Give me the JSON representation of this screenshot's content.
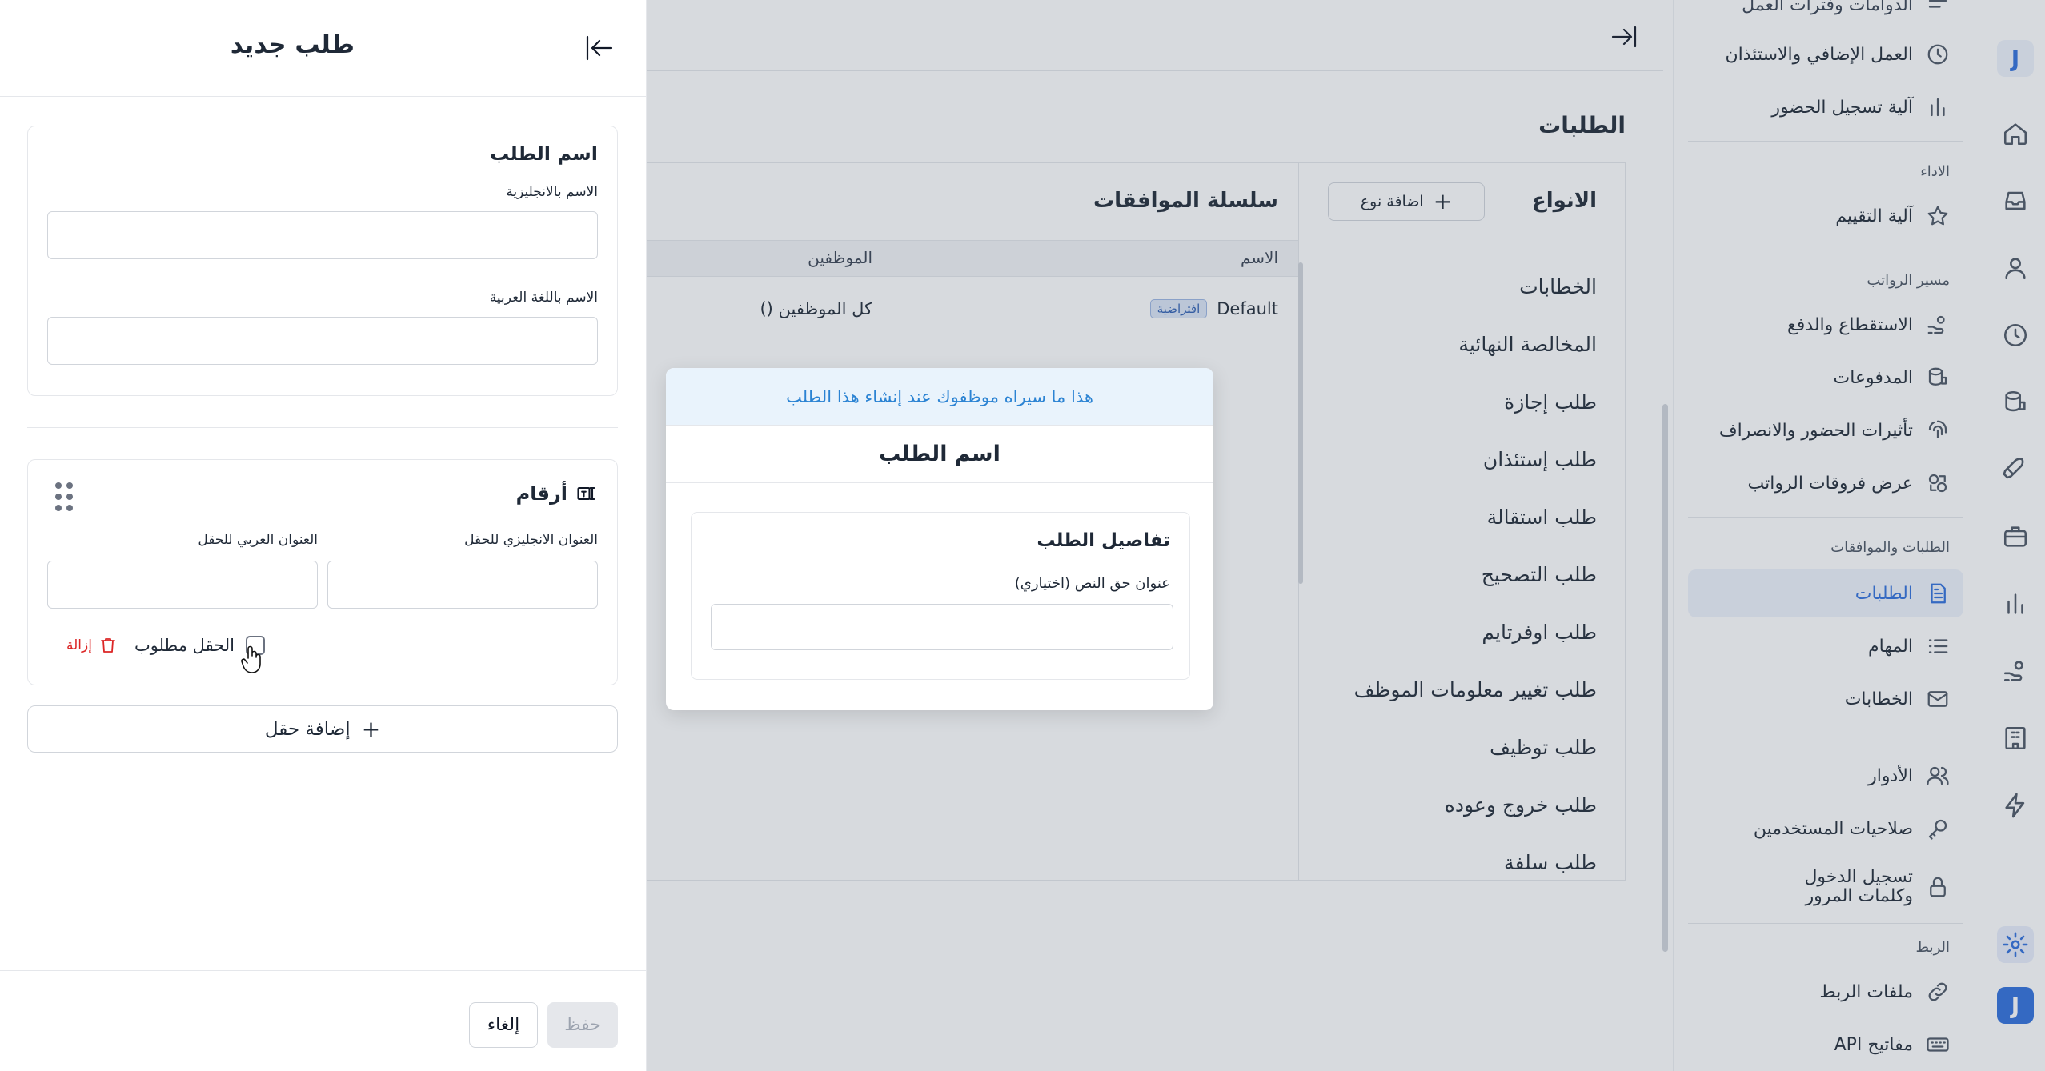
{
  "sidebar": {
    "top_partial": "الدوامات وفترات العمل",
    "items_top": [
      {
        "label": "العمل الإضافي والاستئذان",
        "icon": "clock-plus-icon"
      },
      {
        "label": "آلية تسجيل الحضور",
        "icon": "bar-chart-icon"
      }
    ],
    "section_performance": "الاداء",
    "item_rating": "آلية التقييم",
    "section_payroll": "مسير الرواتب",
    "payroll_items": [
      {
        "label": "الاستقطاع والدفع",
        "icon": "hand-coins-icon"
      },
      {
        "label": "المدفوعات",
        "icon": "coins-stack-icon"
      },
      {
        "label": "تأثيرات الحضور والانصراف",
        "icon": "fingerprint-icon"
      },
      {
        "label": "عرض فروقات الرواتب",
        "icon": "compare-icon"
      }
    ],
    "section_requests": "الطلبات والموافقات",
    "requests_items": [
      {
        "label": "الطلبات",
        "icon": "document-icon"
      },
      {
        "label": "المهام",
        "icon": "list-icon"
      },
      {
        "label": "الخطابات",
        "icon": "mail-icon"
      }
    ],
    "admin_items": [
      {
        "label": "الأدوار",
        "icon": "users-icon"
      },
      {
        "label": "صلاحيات المستخدمين",
        "icon": "key-icon"
      },
      {
        "label": "تسجيل الدخول وكلمات المرور",
        "icon": "lock-icon"
      }
    ],
    "section_integration": "الربط",
    "integration_items": [
      {
        "label": "ملفات الربط",
        "icon": "link-icon"
      },
      {
        "label": "مفاتيح API",
        "icon": "keyboard-icon"
      }
    ]
  },
  "rail": {
    "logo_letter": "J"
  },
  "main": {
    "page_title": "الطلبات",
    "types_title": "الانواع",
    "add_type_label": "اضافة نوع",
    "types": [
      "الخطابات",
      "المخالصة النهائية",
      "طلب إجازة",
      "طلب إستئذان",
      "طلب استقالة",
      "طلب التصحيح",
      "طلب اوفرتايم",
      "طلب تغيير معلومات الموظف",
      "طلب توظيف",
      "طلب خروج وعوده",
      "طلب سلفة"
    ],
    "chain_title": "سلسلة الموافقات",
    "col_name": "الاسم",
    "col_employees": "الموظفين",
    "row_name": "Default",
    "row_badge": "افتراضية",
    "row_employees": "كل الموظفين ()"
  },
  "preview": {
    "banner": "هذا ما سيراه موظفوك عند إنشاء هذا الطلب",
    "title": "اسم الطلب",
    "card_title": "تفاصيل الطلب",
    "field_label": "عنوان حق النص (اختياري)"
  },
  "drawer": {
    "title": "طلب جديد",
    "section_name_title": "اسم الطلب",
    "label_name_en": "الاسم بالانجليزية",
    "label_name_ar": "الاسم باللغة العربية",
    "field_title": "أرقام",
    "label_field_en": "العنوان الانجليزي للحقل",
    "label_field_ar": "العنوان العربي للحقل",
    "required_label": "الحقل مطلوب",
    "remove_label": "إزالة",
    "add_field_label": "إضافة حقل",
    "save_label": "حفظ",
    "cancel_label": "إلغاء"
  },
  "colors": {
    "accent": "#2f6fdc",
    "banner_text": "#2b83d3",
    "danger": "#dc2626"
  }
}
